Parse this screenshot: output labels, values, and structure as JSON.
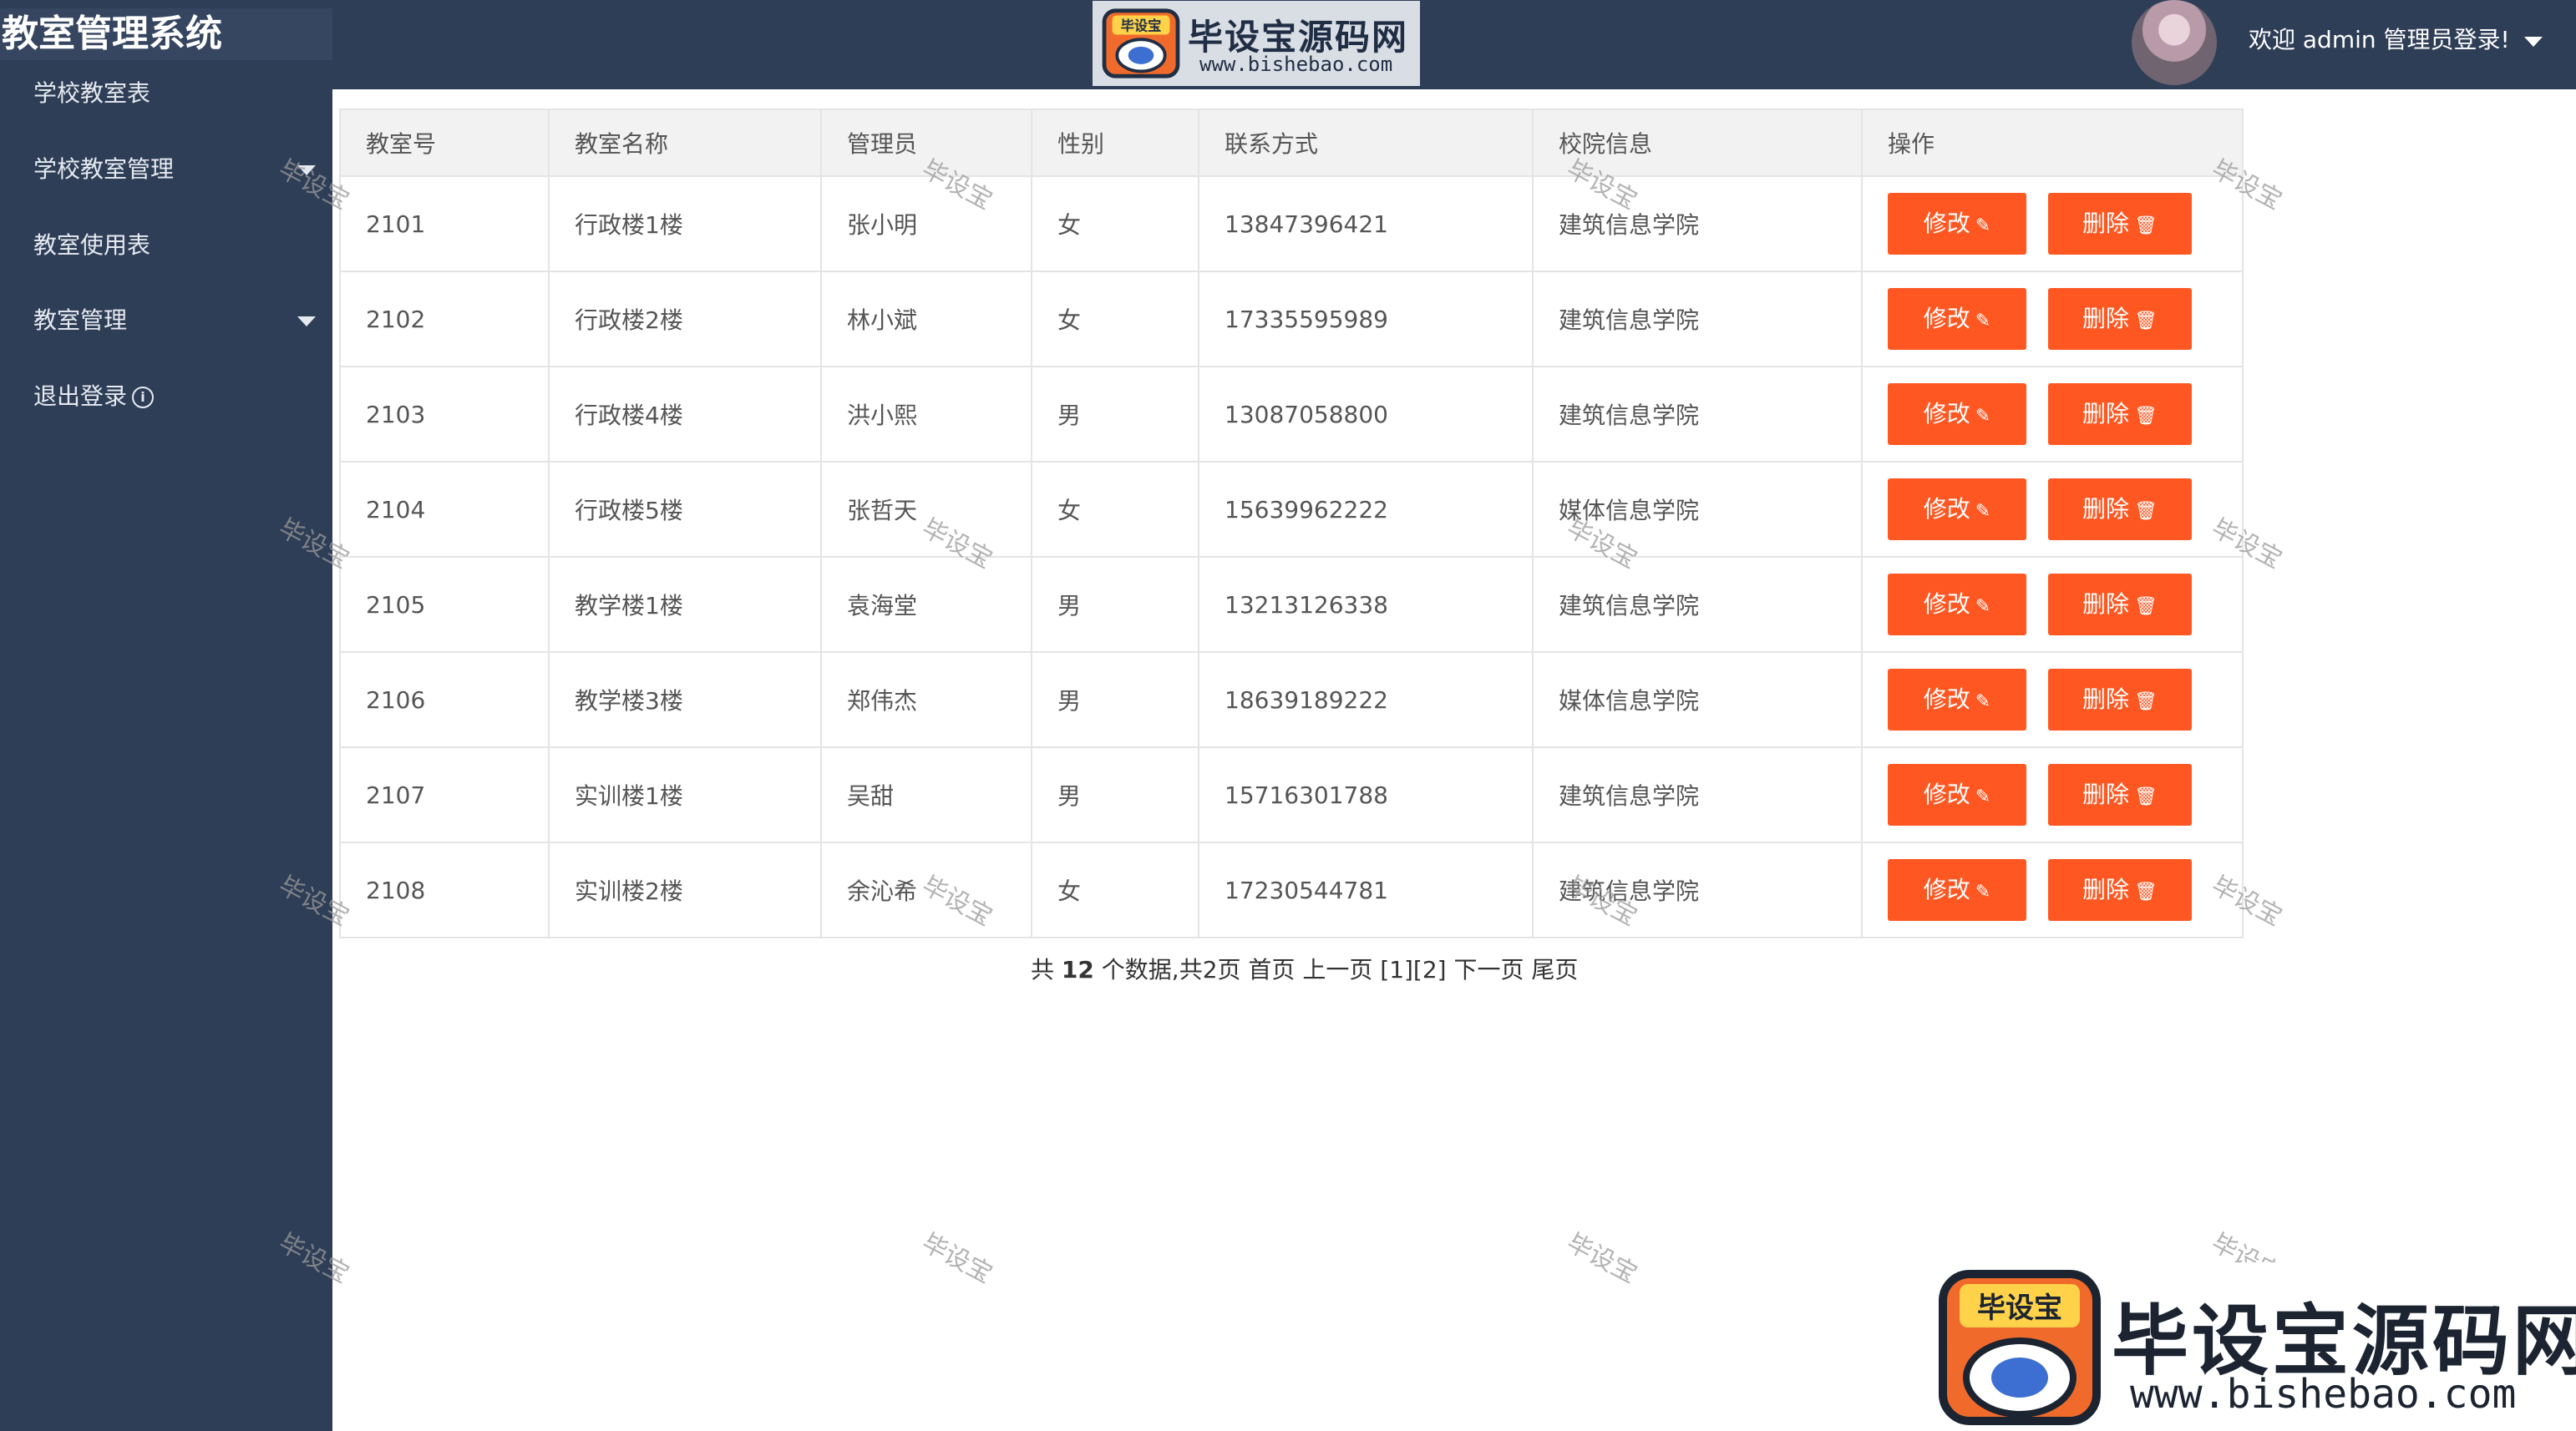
{
  "header": {
    "app_title": "教室管理系统",
    "brand_name": "毕设宝源码网",
    "brand_badge": "毕设宝",
    "brand_url": "www.bishebao.com",
    "welcome": "欢迎 admin 管理员登录!"
  },
  "sidebar": {
    "items": [
      {
        "label": "学校教室表"
      },
      {
        "label": "学校教室管理"
      },
      {
        "label": "教室使用表"
      },
      {
        "label": "教室管理"
      },
      {
        "label": "退出登录"
      }
    ]
  },
  "table": {
    "headers": [
      "教室号",
      "教室名称",
      "管理员",
      "性别",
      "联系方式",
      "校院信息",
      "操作"
    ],
    "rows": [
      [
        "2101",
        "行政楼1楼",
        "张小明",
        "女",
        "13847396421",
        "建筑信息学院"
      ],
      [
        "2102",
        "行政楼2楼",
        "林小斌",
        "女",
        "17335595989",
        "建筑信息学院"
      ],
      [
        "2103",
        "行政楼4楼",
        "洪小熙",
        "男",
        "13087058800",
        "建筑信息学院"
      ],
      [
        "2104",
        "行政楼5楼",
        "张哲天",
        "女",
        "15639962222",
        "媒体信息学院"
      ],
      [
        "2105",
        "教学楼1楼",
        "袁海堂",
        "男",
        "13213126338",
        "建筑信息学院"
      ],
      [
        "2106",
        "教学楼3楼",
        "郑伟杰",
        "男",
        "18639189222",
        "媒体信息学院"
      ],
      [
        "2107",
        "实训楼1楼",
        "吴甜",
        "男",
        "15716301788",
        "建筑信息学院"
      ],
      [
        "2108",
        "实训楼2楼",
        "余沁希",
        "女",
        "17230544781",
        "建筑信息学院"
      ]
    ],
    "edit_label": "修改",
    "delete_label": "删除"
  },
  "pagination": {
    "prefix": "共",
    "total": "12",
    "suffix": "个数据,共2页",
    "first": "首页",
    "prev": "上一页",
    "pages": "[1][2]",
    "next": "下一页",
    "last": "尾页"
  },
  "watermark": "毕设宝",
  "colors": {
    "sidebar_bg": "#2f3e57",
    "button_bg": "#ff5722",
    "header_cell_bg": "#f2f2f2"
  }
}
